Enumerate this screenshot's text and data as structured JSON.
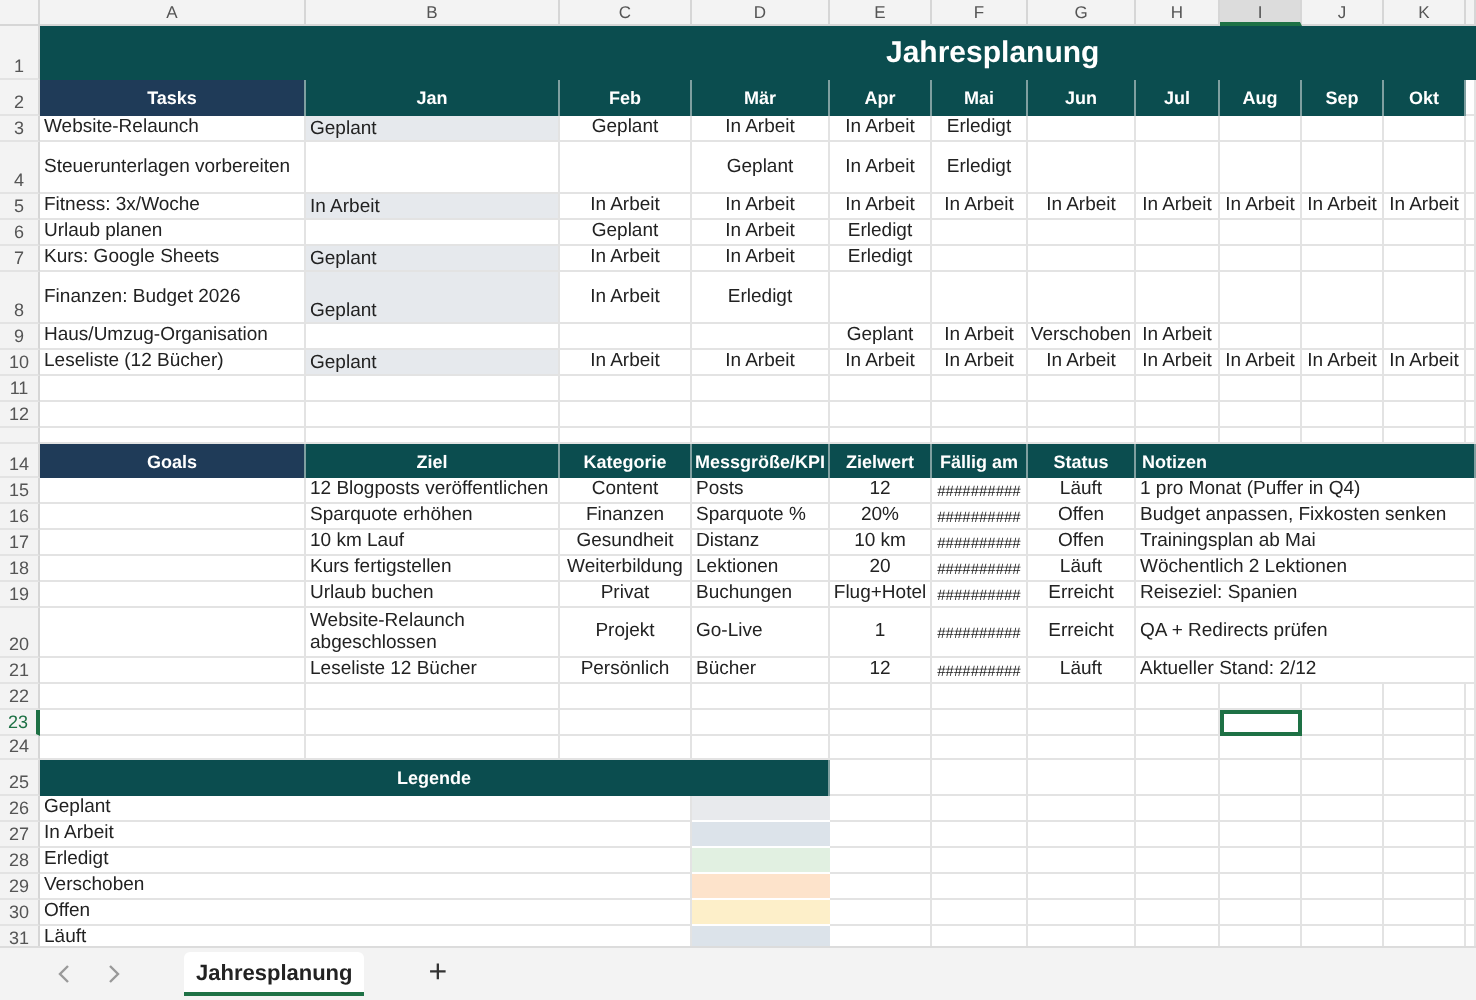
{
  "columns": [
    {
      "label": "A",
      "selected": false
    },
    {
      "label": "B",
      "selected": false
    },
    {
      "label": "C",
      "selected": false
    },
    {
      "label": "D",
      "selected": false
    },
    {
      "label": "E",
      "selected": false
    },
    {
      "label": "F",
      "selected": false
    },
    {
      "label": "G",
      "selected": false
    },
    {
      "label": "H",
      "selected": false
    },
    {
      "label": "I",
      "selected": true
    },
    {
      "label": "J",
      "selected": false
    },
    {
      "label": "K",
      "selected": false
    }
  ],
  "title": {
    "row": "1",
    "text": "Jahresplanung"
  },
  "tasks": {
    "row": "2",
    "headers": [
      "Tasks",
      "Jan",
      "Feb",
      "Mär",
      "Apr",
      "Mai",
      "Jun",
      "Jul",
      "Aug",
      "Sep",
      "Okt"
    ],
    "rows": [
      {
        "row": "3",
        "cells": [
          {
            "text": "Website-Relaunch"
          },
          {
            "text": "Geplant",
            "shaded": true
          },
          {
            "text": "Geplant"
          },
          {
            "text": "In Arbeit"
          },
          {
            "text": "In Arbeit"
          },
          {
            "text": "Erledigt"
          },
          {},
          {},
          {},
          {},
          {}
        ]
      },
      {
        "row": "4",
        "cells": [
          {
            "text": "Steuerunterlagen vorbereiten"
          },
          {},
          {},
          {
            "text": "Geplant"
          },
          {
            "text": "In Arbeit"
          },
          {
            "text": "Erledigt"
          },
          {},
          {},
          {},
          {},
          {}
        ]
      },
      {
        "row": "5",
        "cells": [
          {
            "text": "Fitness: 3x/Woche"
          },
          {
            "text": "In Arbeit",
            "shaded": true
          },
          {
            "text": "In Arbeit"
          },
          {
            "text": "In Arbeit"
          },
          {
            "text": "In Arbeit"
          },
          {
            "text": "In Arbeit"
          },
          {
            "text": "In Arbeit"
          },
          {
            "text": "In Arbeit"
          },
          {
            "text": "In Arbeit"
          },
          {
            "text": "In Arbeit"
          },
          {
            "text": "In Arbeit"
          }
        ]
      },
      {
        "row": "6",
        "cells": [
          {
            "text": "Urlaub planen"
          },
          {},
          {
            "text": "Geplant"
          },
          {
            "text": "In Arbeit"
          },
          {
            "text": "Erledigt"
          },
          {},
          {},
          {},
          {},
          {},
          {}
        ]
      },
      {
        "row": "7",
        "cells": [
          {
            "text": "Kurs: Google Sheets"
          },
          {
            "text": "Geplant",
            "shaded": true
          },
          {
            "text": "In Arbeit"
          },
          {
            "text": "In Arbeit"
          },
          {
            "text": "Erledigt"
          },
          {},
          {},
          {},
          {},
          {},
          {}
        ]
      },
      {
        "row": "8",
        "cells": [
          {
            "text": "Finanzen: Budget 2026"
          },
          {
            "text": "Geplant",
            "shaded": true
          },
          {
            "text": "In Arbeit"
          },
          {
            "text": "Erledigt"
          },
          {},
          {},
          {},
          {},
          {},
          {},
          {}
        ]
      },
      {
        "row": "9",
        "cells": [
          {
            "text": "Haus/Umzug-Organisation"
          },
          {},
          {},
          {},
          {
            "text": "Geplant"
          },
          {
            "text": "In Arbeit"
          },
          {
            "text": "Verschoben"
          },
          {
            "text": "In Arbeit"
          },
          {},
          {},
          {}
        ]
      },
      {
        "row": "10",
        "cells": [
          {
            "text": "Leseliste (12 Bücher)"
          },
          {
            "text": "Geplant",
            "shaded": true
          },
          {
            "text": "In Arbeit"
          },
          {
            "text": "In Arbeit"
          },
          {
            "text": "In Arbeit"
          },
          {
            "text": "In Arbeit"
          },
          {
            "text": "In Arbeit"
          },
          {
            "text": "In Arbeit"
          },
          {
            "text": "In Arbeit"
          },
          {
            "text": "In Arbeit"
          },
          {
            "text": "In Arbeit"
          }
        ]
      }
    ]
  },
  "gap_rows": [
    {
      "row": "11",
      "selected": false
    },
    {
      "row": "12",
      "selected": false
    }
  ],
  "goals": {
    "row": "14",
    "headers": [
      "Goals",
      "Ziel",
      "Kategorie",
      "Messgröße/KPI",
      "Zielwert",
      "Fällig am",
      "Status",
      "Notizen"
    ],
    "rows": [
      {
        "row": "15",
        "cells": [
          "",
          "12 Blogposts veröffentlichen",
          "Content",
          "Posts",
          "12",
          "##########",
          "Läuft",
          "1 pro Monat (Puffer in Q4)"
        ]
      },
      {
        "row": "16",
        "cells": [
          "",
          "Sparquote erhöhen",
          "Finanzen",
          "Sparquote %",
          "20%",
          "##########",
          "Offen",
          "Budget anpassen, Fixkosten senken"
        ]
      },
      {
        "row": "17",
        "cells": [
          "",
          "10 km Lauf",
          "Gesundheit",
          "Distanz",
          "10 km",
          "##########",
          "Offen",
          "Trainingsplan ab Mai"
        ]
      },
      {
        "row": "18",
        "cells": [
          "",
          "Kurs fertigstellen",
          "Weiterbildung",
          "Lektionen",
          "20",
          "##########",
          "Läuft",
          "Wöchentlich 2 Lektionen"
        ]
      },
      {
        "row": "19",
        "cells": [
          "",
          "Urlaub buchen",
          "Privat",
          "Buchungen",
          "Flug+Hotel",
          "##########",
          "Erreicht",
          "Reiseziel: Spanien"
        ]
      },
      {
        "row": "20",
        "cells": [
          "",
          "Website-Relaunch abgeschlossen",
          "Projekt",
          "Go-Live",
          "1",
          "##########",
          "Erreicht",
          "QA + Redirects prüfen"
        ]
      },
      {
        "row": "21",
        "cells": [
          "",
          "Leseliste 12 Bücher",
          "Persönlich",
          "Bücher",
          "12",
          "##########",
          "Läuft",
          "Aktueller Stand: 2/12"
        ]
      }
    ]
  },
  "gap_rows_2": [
    {
      "row": "22",
      "selected": false
    },
    {
      "row": "23",
      "selected": true
    },
    {
      "row": "24",
      "selected": false
    }
  ],
  "legend": {
    "row": "25",
    "title": "Legende",
    "items": [
      {
        "row": "26",
        "label": "Geplant",
        "color": "#e8eaed"
      },
      {
        "row": "27",
        "label": "In Arbeit",
        "color": "#dce3ea"
      },
      {
        "row": "28",
        "label": "Erledigt",
        "color": "#e1f0e1"
      },
      {
        "row": "29",
        "label": "Verschoben",
        "color": "#fde3cb"
      },
      {
        "row": "30",
        "label": "Offen",
        "color": "#fdefc9"
      },
      {
        "row": "31",
        "label": "Läuft",
        "color": "#dce3ea"
      }
    ]
  },
  "sheet_tabs": [
    {
      "label": "Jahresplanung",
      "selected": true
    }
  ],
  "add_sheet": "+"
}
